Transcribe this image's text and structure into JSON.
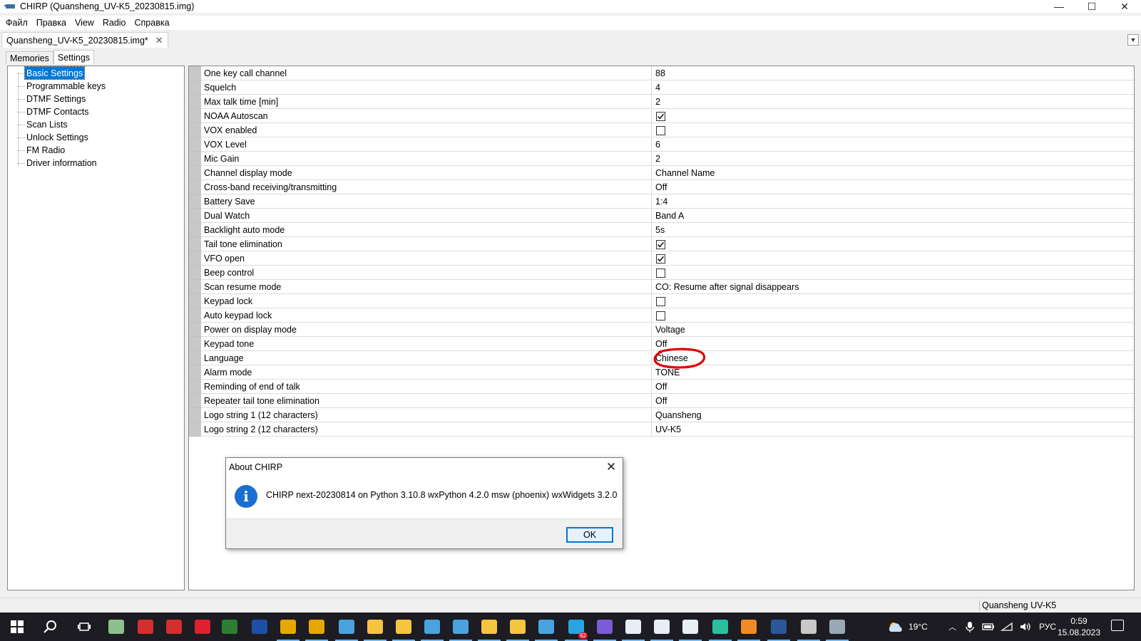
{
  "window": {
    "title": "CHIRP (Quansheng_UV-K5_20230815.img)",
    "minimize_glyph": "—",
    "maximize_glyph": "☐",
    "close_glyph": "✕"
  },
  "menu": [
    "Файл",
    "Правка",
    "View",
    "Radio",
    "Справка"
  ],
  "document_tab": {
    "label": "Quansheng_UV-K5_20230815.img*",
    "close_glyph": "✕"
  },
  "inner_tabs": [
    "Memories",
    "Settings"
  ],
  "active_inner_tab": "Settings",
  "tree": {
    "items": [
      "Basic Settings",
      "Programmable keys",
      "DTMF Settings",
      "DTMF Contacts",
      "Scan Lists",
      "Unlock Settings",
      "FM Radio",
      "Driver information"
    ],
    "selected": "Basic Settings"
  },
  "settings": [
    {
      "label": "One key call channel",
      "value": "88"
    },
    {
      "label": "Squelch",
      "value": "4"
    },
    {
      "label": "Max talk time [min]",
      "value": "2"
    },
    {
      "label": "NOAA Autoscan",
      "checked": true
    },
    {
      "label": "VOX enabled",
      "checked": false
    },
    {
      "label": "VOX Level",
      "value": "6"
    },
    {
      "label": "Mic Gain",
      "value": "2"
    },
    {
      "label": "Channel display mode",
      "value": "Channel Name"
    },
    {
      "label": "Cross-band receiving/transmitting",
      "value": "Off"
    },
    {
      "label": "Battery Save",
      "value": "1:4"
    },
    {
      "label": "Dual Watch",
      "value": "Band A"
    },
    {
      "label": "Backlight auto mode",
      "value": "5s"
    },
    {
      "label": "Tail tone elimination",
      "checked": true
    },
    {
      "label": "VFO open",
      "checked": true
    },
    {
      "label": "Beep control",
      "checked": false
    },
    {
      "label": "Scan resume mode",
      "value": "CO: Resume after signal disappears"
    },
    {
      "label": "Keypad lock",
      "checked": false
    },
    {
      "label": "Auto keypad lock",
      "checked": false
    },
    {
      "label": "Power on display mode",
      "value": "Voltage"
    },
    {
      "label": "Keypad tone",
      "value": "Off"
    },
    {
      "label": "Language",
      "value": "Chinese"
    },
    {
      "label": "Alarm mode",
      "value": "TONE"
    },
    {
      "label": "Reminding of end of talk",
      "value": "Off"
    },
    {
      "label": "Repeater tail tone elimination",
      "value": "Off"
    },
    {
      "label": "Logo string 1 (12 characters)",
      "value": "Quansheng"
    },
    {
      "label": "Logo string 2 (12 characters)",
      "value": "UV-K5"
    }
  ],
  "dialog": {
    "title": "About CHIRP",
    "message": "CHIRP next-20230814 on Python 3.10.8 wxPython 4.2.0 msw (phoenix) wxWidgets 3.2.0",
    "icon_glyph": "i",
    "ok_label": "OK",
    "close_glyph": "✕"
  },
  "status_bar": {
    "text": "Quansheng UV-K5"
  },
  "taskbar": {
    "apps": [
      {
        "name": "start-icon",
        "color": "#ffffff"
      },
      {
        "name": "search-icon",
        "color": "#ffffff"
      },
      {
        "name": "task-view-icon",
        "color": "#ffffff"
      },
      {
        "name": "keyboard-app-icon",
        "color": "#8fbf8f"
      },
      {
        "name": "red-app-icon",
        "color": "#d32f2f"
      },
      {
        "name": "red-app-2-icon",
        "color": "#d32f2f"
      },
      {
        "name": "opera-icon",
        "color": "#e02030"
      },
      {
        "name": "excel-chart-icon",
        "color": "#2e7d32"
      },
      {
        "name": "floppy-icon",
        "color": "#1e4fa8"
      },
      {
        "name": "chrome-icon",
        "color": "#e6a800"
      },
      {
        "name": "chrome-2-icon",
        "color": "#e6a800"
      },
      {
        "name": "bird-app-icon",
        "color": "#4aa3df"
      },
      {
        "name": "folder-icon",
        "color": "#f5c542"
      },
      {
        "name": "folder-2-icon",
        "color": "#f5c542"
      },
      {
        "name": "bird-app-2-icon",
        "color": "#4aa3df"
      },
      {
        "name": "bird-app-3-icon",
        "color": "#4aa3df"
      },
      {
        "name": "folder-3-icon",
        "color": "#f5c542"
      },
      {
        "name": "folder-4-icon",
        "color": "#f5c542"
      },
      {
        "name": "bird-app-4-icon",
        "color": "#4aa3df"
      },
      {
        "name": "telegram-icon",
        "color": "#2aa3e0",
        "badge": "62"
      },
      {
        "name": "viber-icon",
        "color": "#7b5cd6"
      },
      {
        "name": "cube-app-icon",
        "color": "#e8eef5"
      },
      {
        "name": "cube-app-2-icon",
        "color": "#e8eef5"
      },
      {
        "name": "cube-app-3-icon",
        "color": "#e8eef5"
      },
      {
        "name": "text-app-icon",
        "color": "#2bbf9f"
      },
      {
        "name": "magnifier-app-icon",
        "color": "#f08a24"
      },
      {
        "name": "word-icon",
        "color": "#2b579a"
      },
      {
        "name": "printer-app-icon",
        "color": "#c8c8c8"
      },
      {
        "name": "chirp-app-icon",
        "color": "#9aa7b5"
      }
    ],
    "weather": "19°C",
    "language": "РУС",
    "time": "0:59",
    "date": "15.08.2023"
  }
}
